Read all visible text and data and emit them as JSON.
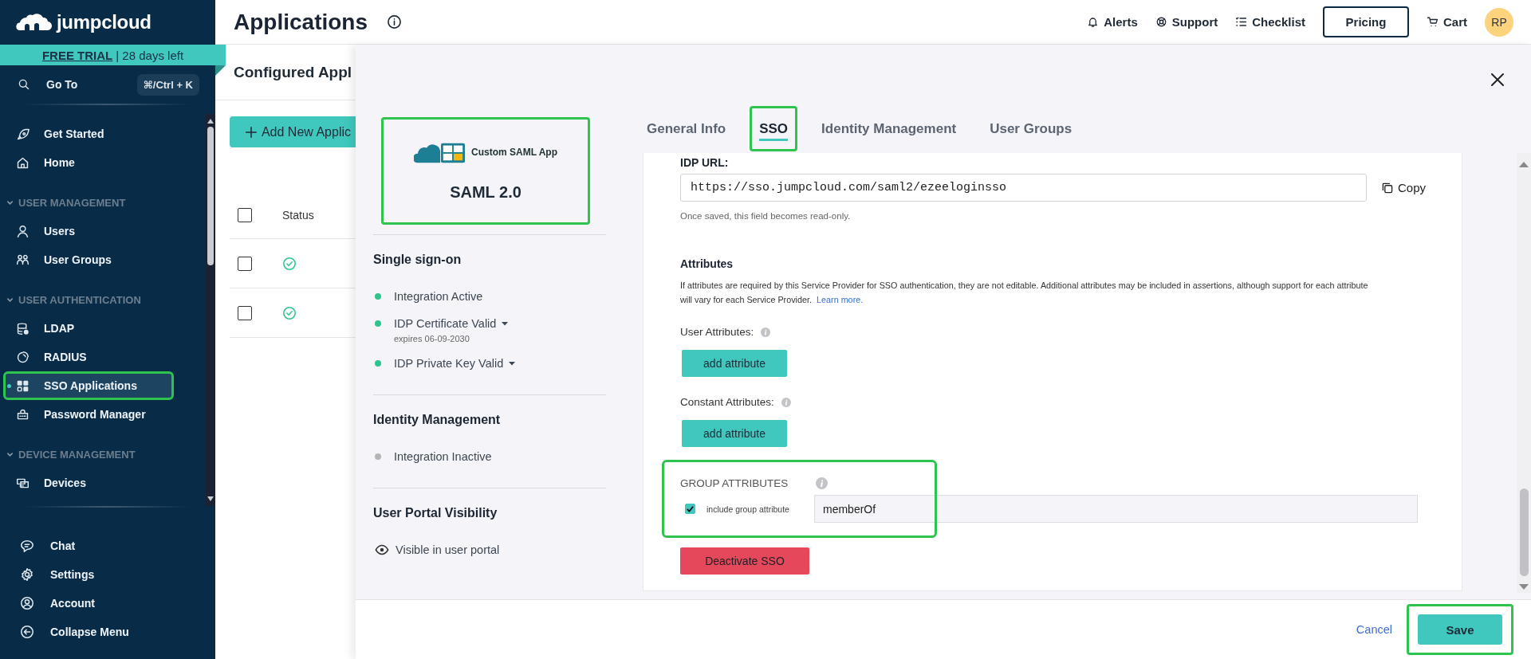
{
  "sidebar": {
    "brand": "jumpcloud",
    "trial": {
      "link": "FREE TRIAL",
      "separator": "|",
      "remaining": "28 days left"
    },
    "goto": {
      "label": "Go To",
      "shortcut": "⌘/Ctrl + K"
    },
    "nav": [
      {
        "kind": "item",
        "label": "Get Started",
        "selected": false,
        "highlighted": false
      },
      {
        "kind": "item",
        "label": "Home",
        "selected": false,
        "highlighted": false
      },
      {
        "kind": "section",
        "label": "USER MANAGEMENT",
        "expanded": true
      },
      {
        "kind": "item",
        "label": "Users",
        "selected": false,
        "highlighted": false
      },
      {
        "kind": "item",
        "label": "User Groups",
        "selected": false,
        "highlighted": false
      },
      {
        "kind": "section",
        "label": "USER AUTHENTICATION",
        "expanded": true
      },
      {
        "kind": "item",
        "label": "LDAP",
        "selected": false,
        "highlighted": false
      },
      {
        "kind": "item",
        "label": "RADIUS",
        "selected": false,
        "highlighted": false
      },
      {
        "kind": "item",
        "label": "SSO Applications",
        "selected": true,
        "highlighted": true
      },
      {
        "kind": "item",
        "label": "Password Manager",
        "selected": false,
        "highlighted": false
      },
      {
        "kind": "section",
        "label": "DEVICE MANAGEMENT",
        "expanded": true
      },
      {
        "kind": "item",
        "label": "Devices",
        "selected": false,
        "highlighted": false
      }
    ],
    "footer_nav": [
      {
        "label": "Chat"
      },
      {
        "label": "Settings"
      },
      {
        "label": "Account"
      },
      {
        "label": "Collapse Menu"
      }
    ]
  },
  "header": {
    "title": "Applications",
    "links": [
      {
        "label": "Alerts"
      },
      {
        "label": "Support"
      },
      {
        "label": "Checklist"
      }
    ],
    "pricing": "Pricing",
    "cart": "Cart",
    "avatar": "RP"
  },
  "page": {
    "heading": "Configured Appl",
    "add_button": "Add New Applic",
    "table": {
      "columns": [
        "Status"
      ],
      "header_checked": false,
      "rows": [
        {
          "checked": false
        },
        {
          "checked": false
        }
      ]
    }
  },
  "modal": {
    "app": {
      "logo_text": "Custom SAML App",
      "protocol": "SAML 2.0",
      "highlighted": true
    },
    "summary": [
      {
        "title": "Single sign-on",
        "items": [
          {
            "kind": "plain",
            "label": "Integration Active",
            "color": "#2fc48d"
          },
          {
            "kind": "dropdown",
            "label": "IDP Certificate Valid",
            "color": "#2fc48d",
            "note": "expires 06-09-2030"
          },
          {
            "kind": "dropdown",
            "label": "IDP Private Key Valid",
            "color": "#2fc48d"
          }
        ]
      },
      {
        "title": "Identity Management",
        "items": [
          {
            "kind": "plain",
            "label": "Integration Inactive",
            "color": "#b5b5b5"
          }
        ]
      },
      {
        "title": "User Portal Visibility",
        "items": [
          {
            "kind": "visibility",
            "label": "Visible in user portal"
          }
        ]
      }
    ],
    "tabs": [
      {
        "label": "General Info",
        "selected": false,
        "highlighted": false
      },
      {
        "label": "SSO",
        "selected": true,
        "highlighted": true
      },
      {
        "label": "Identity Management",
        "selected": false,
        "highlighted": false
      },
      {
        "label": "User Groups",
        "selected": false,
        "highlighted": false
      }
    ],
    "sso": {
      "idp_url": {
        "label": "IDP URL:",
        "value": "https://sso.jumpcloud.com/saml2/ezeeloginsso",
        "copy": "Copy",
        "hint": "Once saved, this field becomes read-only."
      },
      "attributes": {
        "title": "Attributes",
        "description": "If attributes are required by this Service Provider for SSO authentication, they are not editable. Additional attributes may be included in assertions, although support for each attribute will vary for each Service Provider.",
        "link": "Learn more.",
        "groups": [
          {
            "label": "User Attributes:",
            "button": "add attribute"
          },
          {
            "label": "Constant Attributes:",
            "button": "add attribute"
          }
        ]
      },
      "group_attributes": {
        "title": "GROUP ATTRIBUTES",
        "checkbox_label": "include group attribute",
        "checked": true,
        "value": "memberOf",
        "highlighted": true
      },
      "deactivate": "Deactivate SSO"
    },
    "footer": {
      "cancel": "Cancel",
      "save": "Save",
      "save_highlighted": true
    }
  }
}
